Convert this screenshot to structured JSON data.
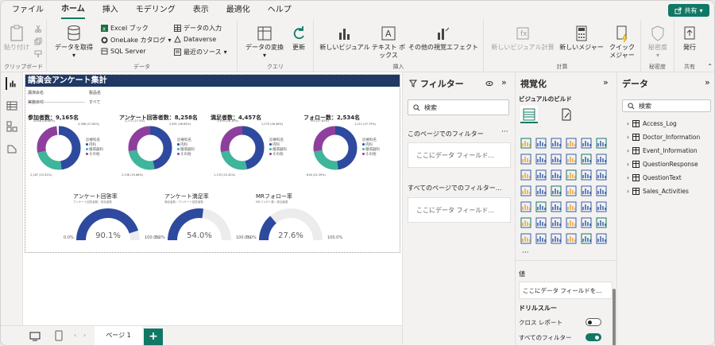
{
  "menu": [
    "ファイル",
    "ホーム",
    "挿入",
    "モデリング",
    "表示",
    "最適化",
    "ヘルプ"
  ],
  "share_label": "共有",
  "ribbon": {
    "clipboard": {
      "paste": "貼り付け",
      "label": "クリップボード"
    },
    "data": {
      "get_data": "データを取得",
      "excel": "Excel ブック",
      "onelake": "OneLake カタログ",
      "sql": "SQL Server",
      "enter_data": "データの入力",
      "dataverse": "Dataverse",
      "recent": "最近のソース",
      "label": "データ"
    },
    "query": {
      "transform": "データの変換",
      "refresh": "更新",
      "label": "クエリ"
    },
    "insert": {
      "new_visual": "新しいビジュアル",
      "textbox": "テキスト ボックス",
      "more_visuals": "その他の視覚エフェクト",
      "label": "挿入"
    },
    "calc": {
      "new_visual_calc": "新しいビジュアル計算",
      "new_measure": "新しいメジャー",
      "quick_measure": "クイック メジャー",
      "label": "計算"
    },
    "sensitivity": {
      "btn": "秘密度",
      "label": "秘密度"
    },
    "share": {
      "publish": "発行",
      "label": "共有"
    }
  },
  "report": {
    "title": "講演会アンケート集計",
    "slicers": [
      {
        "label": "講演会名",
        "value": "すべて"
      },
      {
        "label": "製品名",
        "value": "すべて"
      },
      {
        "label": "実施日付",
        "value": "すべて"
      }
    ],
    "kpis": [
      {
        "label": "参加者数：9,165名"
      },
      {
        "label": "アンケート回答者数：8,258名"
      },
      {
        "label": "満足者数：4,457名"
      },
      {
        "label": "フォロー数：2,534名"
      }
    ],
    "donut_legend": {
      "title": "診療科名",
      "items": [
        "内科",
        "循環器科",
        "その他"
      ]
    },
    "donut_labels": [
      {
        "top": "2,028 (26.86%)",
        "right": "4,388 (47.84%)",
        "bottom": "2,187 (23.52%)"
      },
      {
        "top": "2,271 (27.5%)",
        "right": "3,851 (46.64%)",
        "bottom": "2,136 (25.86%)"
      },
      {
        "top": "1,254 (28.16%)",
        "right": "2,070 (46.46%)",
        "bottom": "1,133 (25.42%)"
      },
      {
        "top": "705 (27.82%)",
        "right": "1,211 (47.79%)",
        "bottom": "618 (24.39%)"
      }
    ],
    "donut_colors": [
      "#2e4a9e",
      "#3fb59b",
      "#8e3f9e"
    ],
    "gauges": [
      {
        "title": "アンケート回答率",
        "subtitle": "アンケート回答者数／参加者数",
        "value": 90.1,
        "value_text": "90.1%",
        "min": "0.0%",
        "max": "100.0%"
      },
      {
        "title": "アンケート満足率",
        "subtitle": "満足者数／アンケート回答者数",
        "value": 54.0,
        "value_text": "54.0%",
        "min": "0.0%",
        "max": "100.0%"
      },
      {
        "title": "MRフォロー率",
        "subtitle": "MRフォロー数／参加者数",
        "value": 27.6,
        "value_text": "27.6%",
        "min": "0.0%",
        "max": "100.0%"
      }
    ],
    "gauge_color": "#2e4a9e"
  },
  "page_tab": "ページ 1",
  "filters": {
    "title": "フィルター",
    "search": "検索",
    "this_page": "このページでのフィルター",
    "all_pages": "すべてのページでのフィルター...",
    "drop_here": "ここにデータ フィールド..."
  },
  "viz": {
    "title": "視覚化",
    "build": "ビジュアルのビルド",
    "value_label": "値",
    "value_drop": "ここにデータ フィールドを...",
    "drillthrough": "ドリルスルー",
    "cross_report": "クロス レポート",
    "keep_filters": "すべてのフィルター"
  },
  "datapane": {
    "title": "データ",
    "search": "検索",
    "tables": [
      "Access_Log",
      "Doctor_Information",
      "Event_Information",
      "QuestionResponse",
      "QuestionText",
      "Sales_Activities"
    ]
  }
}
